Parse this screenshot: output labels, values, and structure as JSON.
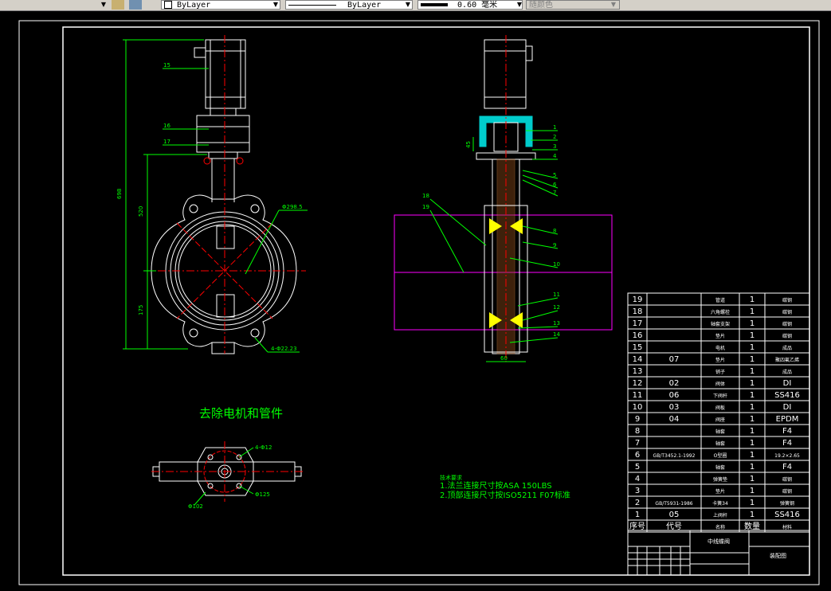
{
  "toolbar": {
    "layer_color": "ByLayer",
    "linetype": "ByLayer",
    "lineweight": "0.60 毫米",
    "plotstyle": "随颜色"
  },
  "drawing": {
    "front_view": {
      "dim_total_height": "698",
      "dim_upper": "520",
      "dim_lower": "175",
      "dim_bore": "Φ298.5",
      "dim_bolts": "4-Φ22.23",
      "label_15": "15",
      "label_16": "16",
      "label_17": "17"
    },
    "top_view": {
      "caption": "去除电机和管件",
      "dim_holes": "4-Φ12",
      "dim_pcd": "Φ125",
      "dim_outer": "Φ102"
    },
    "side_view": {
      "dim_height": "45",
      "dim_width": "60",
      "balloons_right": [
        "1",
        "2",
        "3",
        "4",
        "5",
        "6",
        "7",
        "8",
        "9",
        "10",
        "11",
        "12",
        "13",
        "14"
      ],
      "balloons_left": [
        "18",
        "19"
      ]
    },
    "notes": {
      "heading": "技术要求",
      "line1": "1.法兰连接尺寸按ASA 150LBS",
      "line2": "2.顶部连接尺寸按ISO5211 F07标准"
    }
  },
  "bom": {
    "rows": [
      {
        "no": "19",
        "code": "",
        "name": "管道",
        "qty": "1",
        "material": "碳钢"
      },
      {
        "no": "18",
        "code": "",
        "name": "六角螺栓",
        "qty": "1",
        "material": "碳钢"
      },
      {
        "no": "17",
        "code": "",
        "name": "轴套支架",
        "qty": "1",
        "material": "碳钢"
      },
      {
        "no": "16",
        "code": "",
        "name": "垫片",
        "qty": "1",
        "material": "碳钢"
      },
      {
        "no": "15",
        "code": "",
        "name": "电机",
        "qty": "1",
        "material": "成品"
      },
      {
        "no": "14",
        "code": "07",
        "name": "垫片",
        "qty": "1",
        "material": "聚四氟乙烯"
      },
      {
        "no": "13",
        "code": "",
        "name": "销子",
        "qty": "1",
        "material": "成品"
      },
      {
        "no": "12",
        "code": "02",
        "name": "阀体",
        "qty": "1",
        "material": "DI"
      },
      {
        "no": "11",
        "code": "06",
        "name": "下阀杆",
        "qty": "1",
        "material": "SS416"
      },
      {
        "no": "10",
        "code": "03",
        "name": "阀板",
        "qty": "1",
        "material": "DI"
      },
      {
        "no": "9",
        "code": "04",
        "name": "阀座",
        "qty": "1",
        "material": "EPDM"
      },
      {
        "no": "8",
        "code": "",
        "name": "轴套",
        "qty": "1",
        "material": "F4"
      },
      {
        "no": "7",
        "code": "",
        "name": "轴套",
        "qty": "1",
        "material": "F4"
      },
      {
        "no": "6",
        "code": "GB/T3452.1-1992",
        "name": "O型圈",
        "qty": "1",
        "material": "19.2×2.65"
      },
      {
        "no": "5",
        "code": "",
        "name": "轴套",
        "qty": "1",
        "material": "F4"
      },
      {
        "no": "4",
        "code": "",
        "name": "弹簧垫",
        "qty": "1",
        "material": "碳钢"
      },
      {
        "no": "3",
        "code": "",
        "name": "垫片",
        "qty": "1",
        "material": "碳钢"
      },
      {
        "no": "2",
        "code": "GB/T5931-1986",
        "name": "卡簧34",
        "qty": "1",
        "material": "弹簧钢"
      },
      {
        "no": "1",
        "code": "05",
        "name": "上阀杆",
        "qty": "1",
        "material": "SS416"
      }
    ],
    "header": {
      "no": "序号",
      "code": "代号",
      "name": "名称",
      "qty": "数量",
      "material": "材料"
    },
    "title_block": {
      "title": "中线蝶阀",
      "drawing_name": "装配图"
    }
  }
}
